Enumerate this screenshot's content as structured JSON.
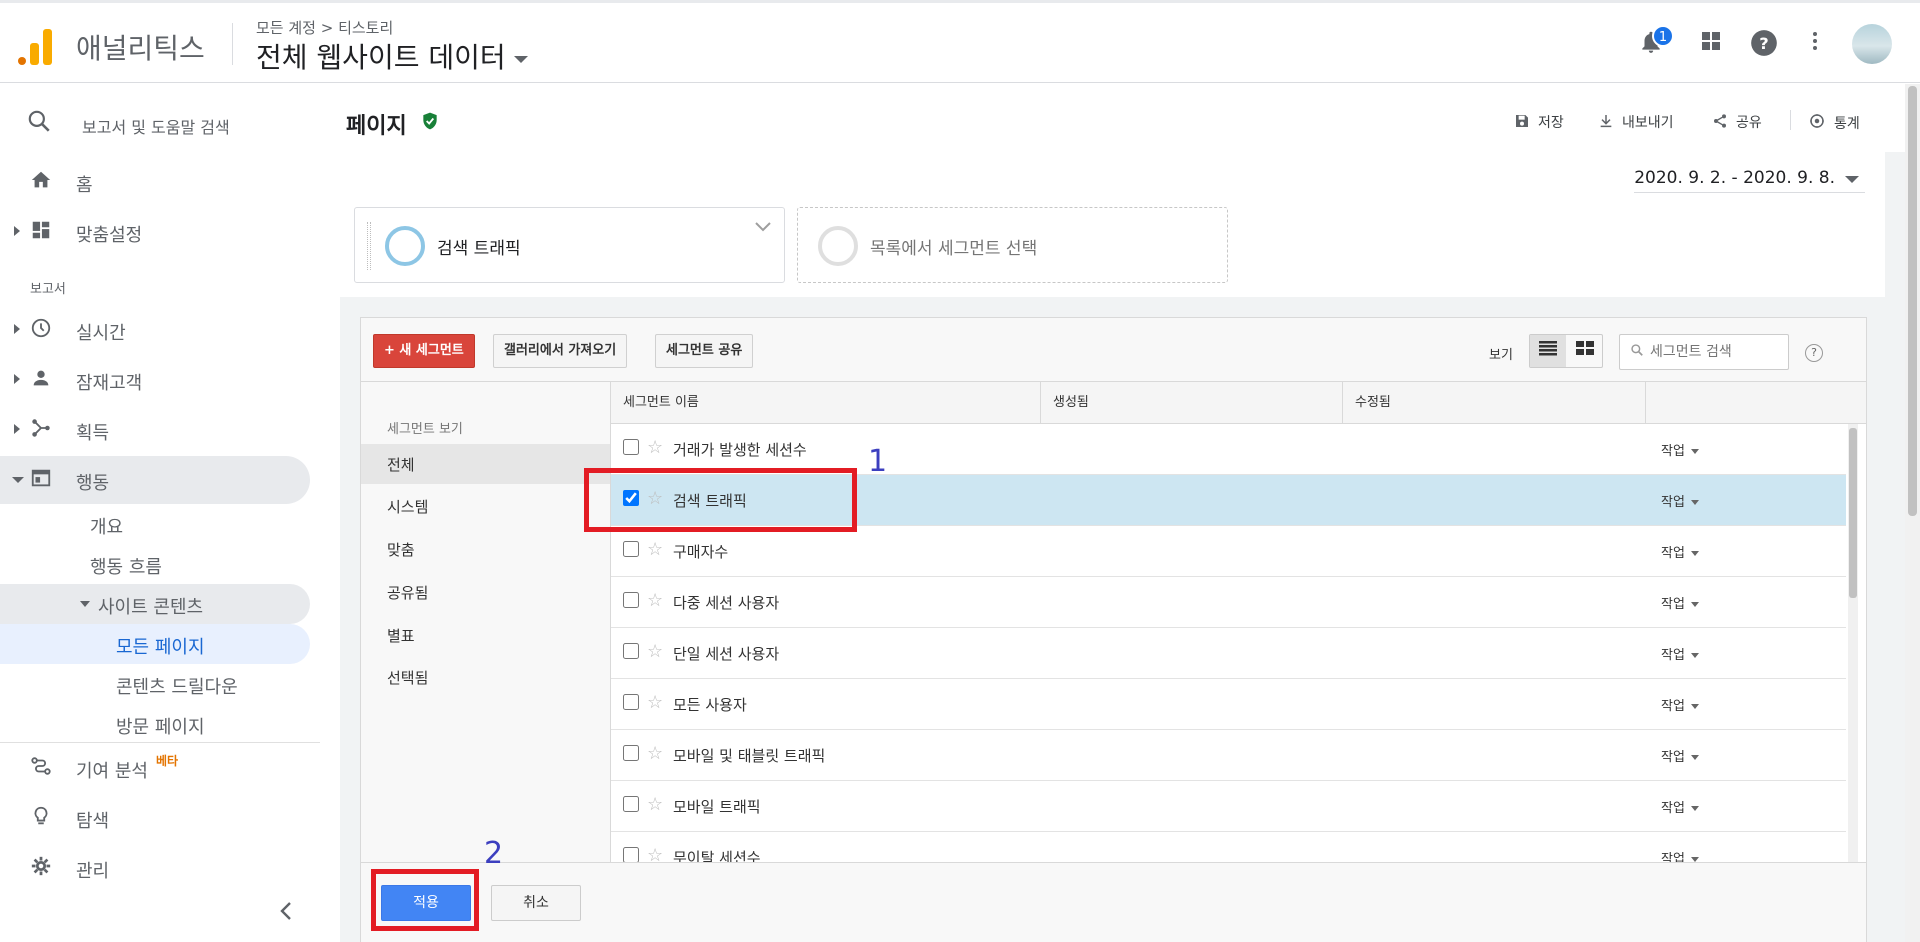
{
  "header": {
    "app_name": "애널리틱스",
    "breadcrumb": "모든 계정 > 티스토리",
    "property": "전체 웹사이트 데이터",
    "notification_count": "1"
  },
  "sidebar": {
    "search_label": "보고서 및 도움말 검색",
    "home": "홈",
    "customization": "맞춤설정",
    "reports_section": "보고서",
    "realtime": "실시간",
    "audience": "잠재고객",
    "acquisition": "획득",
    "behavior": "행동",
    "behavior_children": {
      "overview": "개요",
      "flow": "행동 흐름",
      "site_content": "사이트 콘텐츠",
      "site_content_children": {
        "all_pages": "모든 페이지",
        "drilldown": "콘텐츠 드릴다운",
        "landing": "방문 페이지"
      }
    },
    "attribution": "기여 분석",
    "attribution_badge": "베타",
    "discover": "탐색",
    "admin": "관리"
  },
  "page": {
    "title": "페이지",
    "actions": {
      "save": "저장",
      "export": "내보내기",
      "share": "공유",
      "insights": "통계"
    },
    "date_range": "2020. 9. 2. - 2020. 9. 8."
  },
  "segments": {
    "active": "검색 트래픽",
    "placeholder": "목록에서 세그먼트 선택"
  },
  "panel": {
    "new_segment": "+ 새 세그먼트",
    "import_gallery": "갤러리에서 가져오기",
    "share_segment": "세그먼트 공유",
    "view_label": "보기",
    "search_placeholder": "세그먼트 검색",
    "filter_heading": "세그먼트 보기",
    "filters": [
      "전체",
      "시스템",
      "맞춤",
      "공유됨",
      "별표",
      "선택됨"
    ],
    "columns": {
      "name": "세그먼트 이름",
      "created": "생성됨",
      "modified": "수정됨"
    },
    "work_label": "작업",
    "rows": [
      {
        "name": "거래가 발생한 세션수",
        "checked": false
      },
      {
        "name": "검색 트래픽",
        "checked": true
      },
      {
        "name": "구매자수",
        "checked": false
      },
      {
        "name": "다중 세션 사용자",
        "checked": false
      },
      {
        "name": "단일 세션 사용자",
        "checked": false
      },
      {
        "name": "모든 사용자",
        "checked": false
      },
      {
        "name": "모바일 및 태블릿 트래픽",
        "checked": false
      },
      {
        "name": "모바일 트래픽",
        "checked": false
      },
      {
        "name": "무이탈 세션수",
        "checked": false
      }
    ],
    "apply": "적용",
    "cancel": "취소"
  },
  "annotations": {
    "one": "1",
    "two": "2"
  },
  "colors": {
    "accent_blue": "#4285f4",
    "new_segment_red": "#d9453b",
    "annotation_red": "#e31c24",
    "annotation_number": "#3c3fbf"
  }
}
